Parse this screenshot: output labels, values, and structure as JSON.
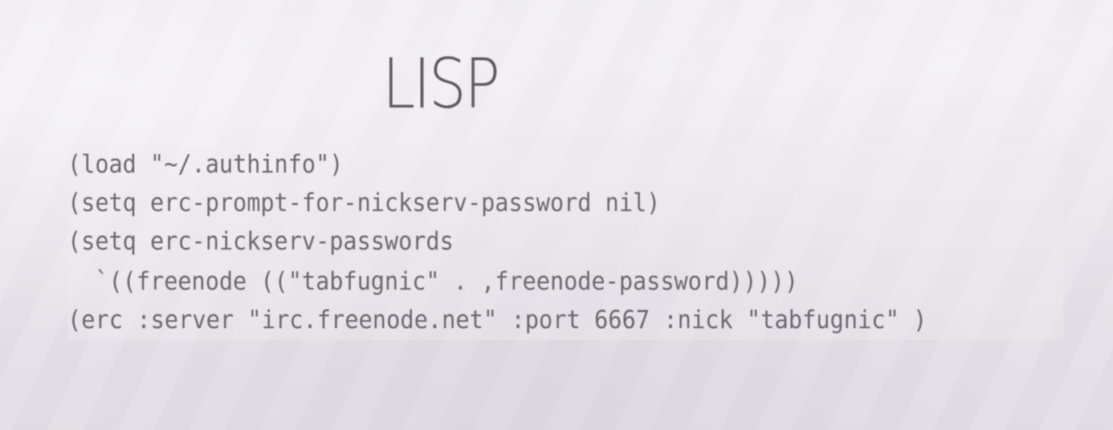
{
  "slide": {
    "title": "LISP",
    "code_lines": [
      "(load \"~/.authinfo\")",
      "(setq erc-prompt-for-nickserv-password nil)",
      "(setq erc-nickserv-passwords",
      "  `((freenode ((\"tabfugnic\" . ,freenode-password)))))",
      "(erc :server \"irc.freenode.net\" :port 6667 :nick \"tabfugnic\" )"
    ]
  }
}
